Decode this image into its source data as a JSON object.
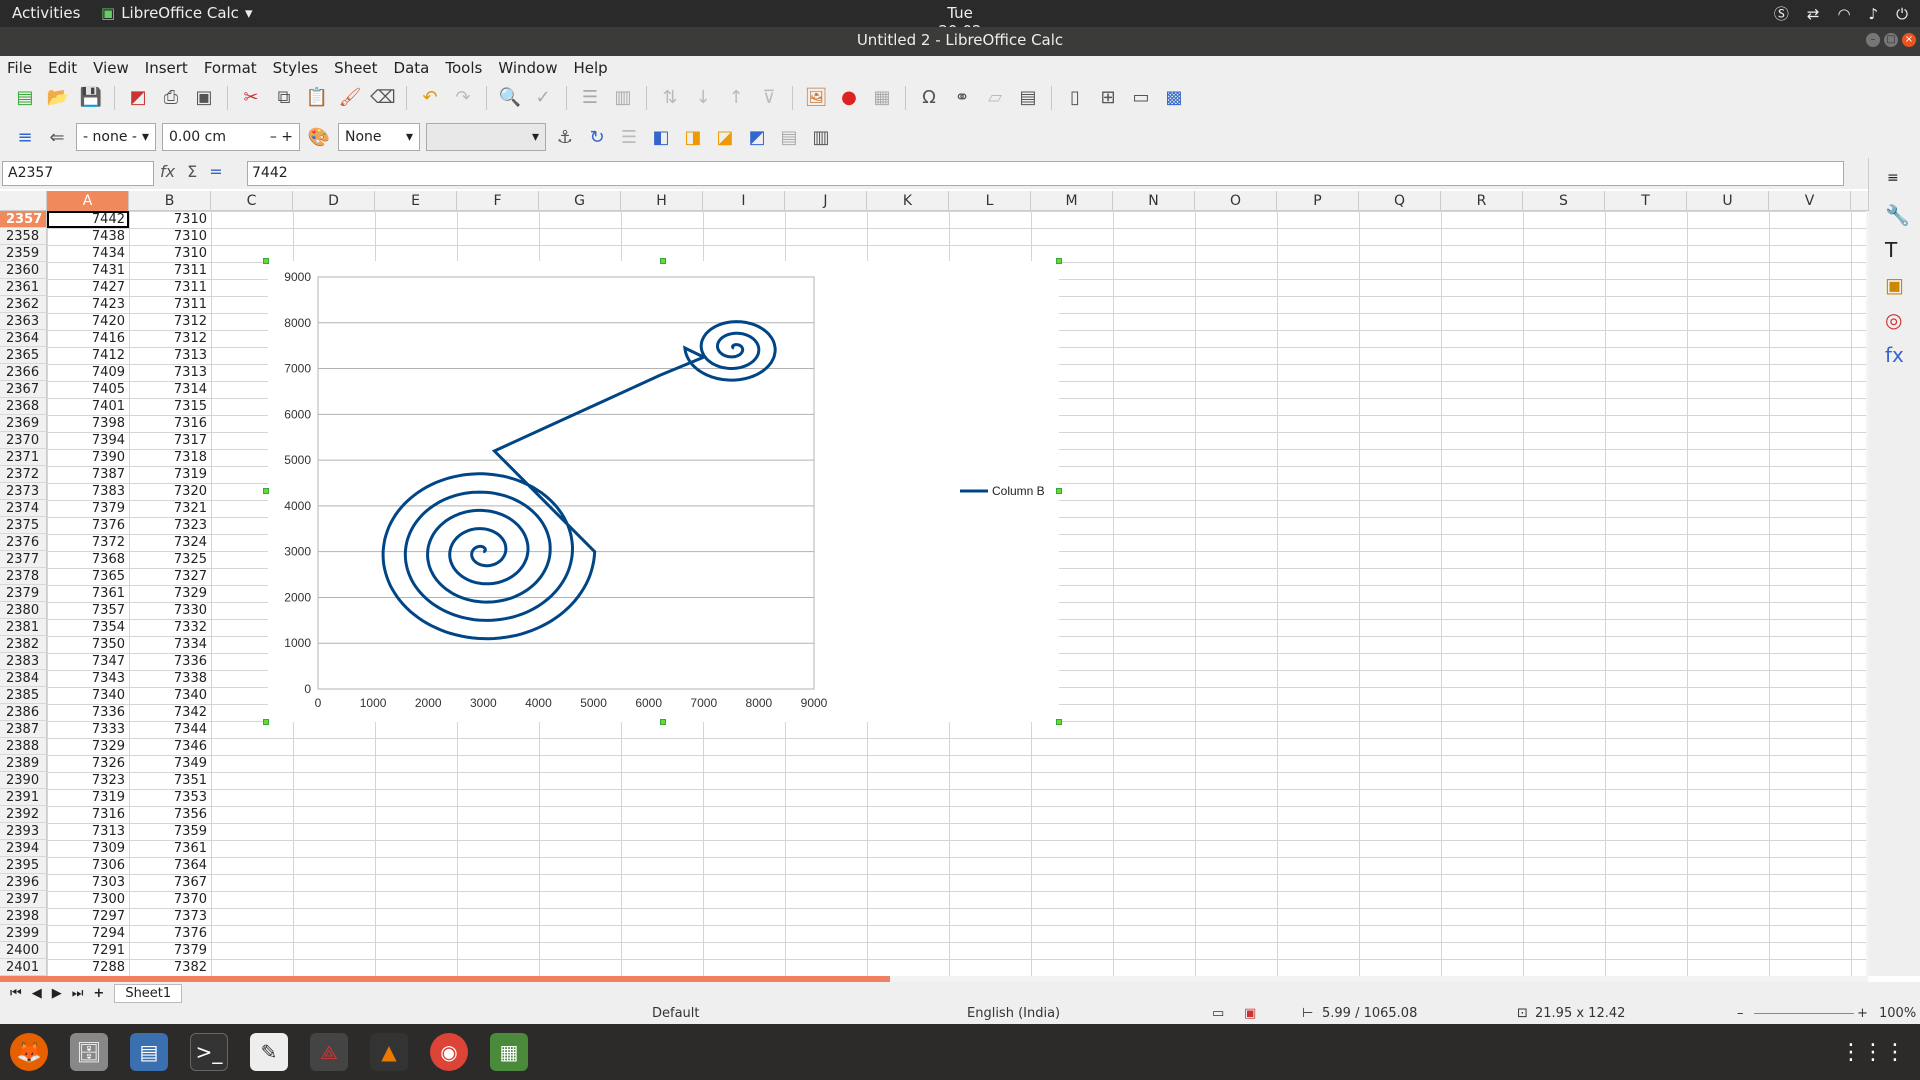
{
  "topbar": {
    "activities": "Activities",
    "app_name": "LibreOffice Calc",
    "clock": "Tue 20:02"
  },
  "window": {
    "title": "Untitled 2 - LibreOffice Calc"
  },
  "menu": [
    "File",
    "Edit",
    "View",
    "Insert",
    "Format",
    "Styles",
    "Sheet",
    "Data",
    "Tools",
    "Window",
    "Help"
  ],
  "toolbar2": {
    "line_style": "- none -",
    "line_width": "0.00 cm",
    "area_style": "None",
    "area_fill": ""
  },
  "formula_bar": {
    "name_box": "A2357",
    "content": "7442"
  },
  "columns": [
    "A",
    "B",
    "C",
    "D",
    "E",
    "F",
    "G",
    "H",
    "I",
    "J",
    "K",
    "L",
    "M",
    "N",
    "O",
    "P",
    "Q",
    "R",
    "S",
    "T",
    "U",
    "V"
  ],
  "rows": [
    {
      "n": "2357",
      "a": "7442",
      "b": "7310"
    },
    {
      "n": "2358",
      "a": "7438",
      "b": "7310"
    },
    {
      "n": "2359",
      "a": "7434",
      "b": "7310"
    },
    {
      "n": "2360",
      "a": "7431",
      "b": "7311"
    },
    {
      "n": "2361",
      "a": "7427",
      "b": "7311"
    },
    {
      "n": "2362",
      "a": "7423",
      "b": "7311"
    },
    {
      "n": "2363",
      "a": "7420",
      "b": "7312"
    },
    {
      "n": "2364",
      "a": "7416",
      "b": "7312"
    },
    {
      "n": "2365",
      "a": "7412",
      "b": "7313"
    },
    {
      "n": "2366",
      "a": "7409",
      "b": "7313"
    },
    {
      "n": "2367",
      "a": "7405",
      "b": "7314"
    },
    {
      "n": "2368",
      "a": "7401",
      "b": "7315"
    },
    {
      "n": "2369",
      "a": "7398",
      "b": "7316"
    },
    {
      "n": "2370",
      "a": "7394",
      "b": "7317"
    },
    {
      "n": "2371",
      "a": "7390",
      "b": "7318"
    },
    {
      "n": "2372",
      "a": "7387",
      "b": "7319"
    },
    {
      "n": "2373",
      "a": "7383",
      "b": "7320"
    },
    {
      "n": "2374",
      "a": "7379",
      "b": "7321"
    },
    {
      "n": "2375",
      "a": "7376",
      "b": "7323"
    },
    {
      "n": "2376",
      "a": "7372",
      "b": "7324"
    },
    {
      "n": "2377",
      "a": "7368",
      "b": "7325"
    },
    {
      "n": "2378",
      "a": "7365",
      "b": "7327"
    },
    {
      "n": "2379",
      "a": "7361",
      "b": "7329"
    },
    {
      "n": "2380",
      "a": "7357",
      "b": "7330"
    },
    {
      "n": "2381",
      "a": "7354",
      "b": "7332"
    },
    {
      "n": "2382",
      "a": "7350",
      "b": "7334"
    },
    {
      "n": "2383",
      "a": "7347",
      "b": "7336"
    },
    {
      "n": "2384",
      "a": "7343",
      "b": "7338"
    },
    {
      "n": "2385",
      "a": "7340",
      "b": "7340"
    },
    {
      "n": "2386",
      "a": "7336",
      "b": "7342"
    },
    {
      "n": "2387",
      "a": "7333",
      "b": "7344"
    },
    {
      "n": "2388",
      "a": "7329",
      "b": "7346"
    },
    {
      "n": "2389",
      "a": "7326",
      "b": "7349"
    },
    {
      "n": "2390",
      "a": "7323",
      "b": "7351"
    },
    {
      "n": "2391",
      "a": "7319",
      "b": "7353"
    },
    {
      "n": "2392",
      "a": "7316",
      "b": "7356"
    },
    {
      "n": "2393",
      "a": "7313",
      "b": "7359"
    },
    {
      "n": "2394",
      "a": "7309",
      "b": "7361"
    },
    {
      "n": "2395",
      "a": "7306",
      "b": "7364"
    },
    {
      "n": "2396",
      "a": "7303",
      "b": "7367"
    },
    {
      "n": "2397",
      "a": "7300",
      "b": "7370"
    },
    {
      "n": "2398",
      "a": "7297",
      "b": "7373"
    },
    {
      "n": "2399",
      "a": "7294",
      "b": "7376"
    },
    {
      "n": "2400",
      "a": "7291",
      "b": "7379"
    },
    {
      "n": "2401",
      "a": "7288",
      "b": "7382"
    }
  ],
  "sheet_tab": "Sheet1",
  "status": {
    "page_style": "Default",
    "language": "English (India)",
    "position": "5.99 / 1065.08",
    "size": "21.95 x 12.42",
    "zoom": "100%"
  },
  "chart_data": {
    "type": "scatter",
    "series": [
      {
        "name": "Column B",
        "color": "#004586",
        "points": []
      }
    ],
    "xlim": [
      0,
      9000
    ],
    "ylim": [
      0,
      9000
    ],
    "xticks": [
      0,
      1000,
      2000,
      3000,
      4000,
      5000,
      6000,
      7000,
      8000,
      9000
    ],
    "yticks": [
      0,
      1000,
      2000,
      3000,
      4000,
      5000,
      6000,
      7000,
      8000,
      9000
    ],
    "grid": "horizontal",
    "legend": "right"
  }
}
